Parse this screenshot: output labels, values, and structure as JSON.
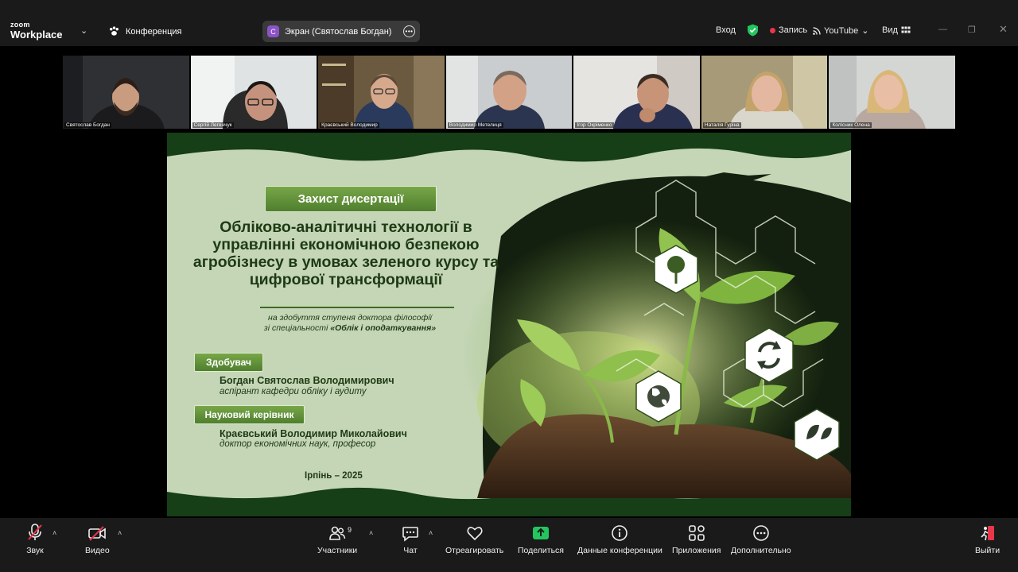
{
  "titlebar": {
    "logo_top": "zoom",
    "logo_bottom": "Workplace",
    "conference_label": "Конференция",
    "screen_share_avatar": "С",
    "screen_share_label": "Экран (Святослав Богдан)",
    "signin_label": "Вход",
    "record_label": "Запись",
    "youtube_label": "YouTube",
    "view_label": "Вид",
    "record_color": "#e8364a",
    "shield_color": "#23c55e"
  },
  "participants": [
    {
      "name": "Святослав Богдан"
    },
    {
      "name": "Сергій Легенчук"
    },
    {
      "name": "Краєвський Володимир"
    },
    {
      "name": "Володимир Метелиця",
      "active": true
    },
    {
      "name": "Ігор Окріменко"
    },
    {
      "name": "Наталія Гуріна"
    },
    {
      "name": "Колісник Олена"
    }
  ],
  "slide": {
    "badge": "Захист дисертації",
    "title": "Обліково-аналітичні технології в управлінні економічною безпекою агробізнесу в умовах зеленого курсу та цифрової трансформації",
    "subtitle_line1": "на здобуття ступеня доктора філософії",
    "subtitle_line2_prefix": "зі спеціальності",
    "subtitle_specialty": "«Облік і оподаткування»",
    "applicant_label": "Здобувач",
    "applicant_name": "Богдан Святослав Володимирович",
    "applicant_role": "аспірант кафедри обліку і аудиту",
    "supervisor_label": "Науковий керівник",
    "supervisor_name": "Краєвський Володимир Миколайович",
    "supervisor_role": "доктор економічних наук, професор",
    "place_year": "Ірпінь – 2025",
    "accent_color": "#5a8a33",
    "background_color": "#c4d6b6"
  },
  "toolbar": {
    "audio_label": "Звук",
    "video_label": "Видео",
    "participants_label": "Участники",
    "participants_count": "9",
    "chat_label": "Чат",
    "react_label": "Отреагировать",
    "share_label": "Поделиться",
    "meeting_info_label": "Данные конференции",
    "apps_label": "Приложения",
    "more_label": "Дополнительно",
    "leave_label": "Выйти",
    "share_color": "#23c55e",
    "muted_color": "#e8364a"
  }
}
